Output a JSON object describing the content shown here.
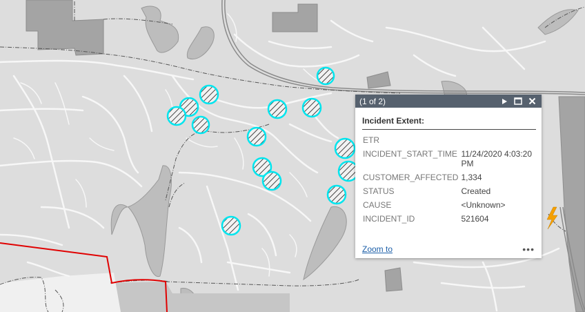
{
  "popup": {
    "count": "(1 of 2)",
    "title": "Incident Extent:",
    "attributes": [
      {
        "key": "ETR",
        "value": ""
      },
      {
        "key": "INCIDENT_START_TIME",
        "value": "11/24/2020 4:03:20 PM"
      },
      {
        "key": "CUSTOMER_AFFECTED",
        "value": "1,334"
      },
      {
        "key": "STATUS",
        "value": "Created"
      },
      {
        "key": "CAUSE",
        "value": "<Unknown>"
      },
      {
        "key": "INCIDENT_ID",
        "value": "521604"
      }
    ],
    "zoom_label": "Zoom to",
    "more_label": "•••",
    "icons": [
      "next-arrow-icon",
      "maximize-icon",
      "close-icon"
    ]
  },
  "map": {
    "incident_color": "#00e5ee",
    "boundary_color": "#e00000",
    "outage_icon_color": "#f5a000",
    "icons": [
      "hatched-incident-icon",
      "lightning-outage-icon"
    ]
  }
}
